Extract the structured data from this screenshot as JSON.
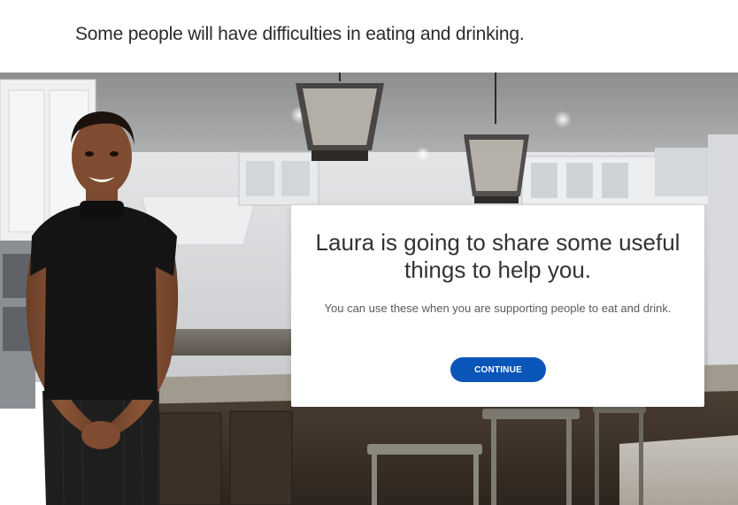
{
  "header": {
    "text": "Some people will have difficulties in eating and drinking."
  },
  "scene": {
    "background_image": "kitchen-photo",
    "presenter_image": "presenter-laura-photo"
  },
  "card": {
    "title": "Laura is going to share some useful things to help you.",
    "body": "You can use these when you are supporting people to eat and drink.",
    "continue_label": "CONTINUE"
  },
  "colors": {
    "button": "#0a56b8",
    "title_text": "#333333",
    "body_text": "#5a5a5a"
  }
}
